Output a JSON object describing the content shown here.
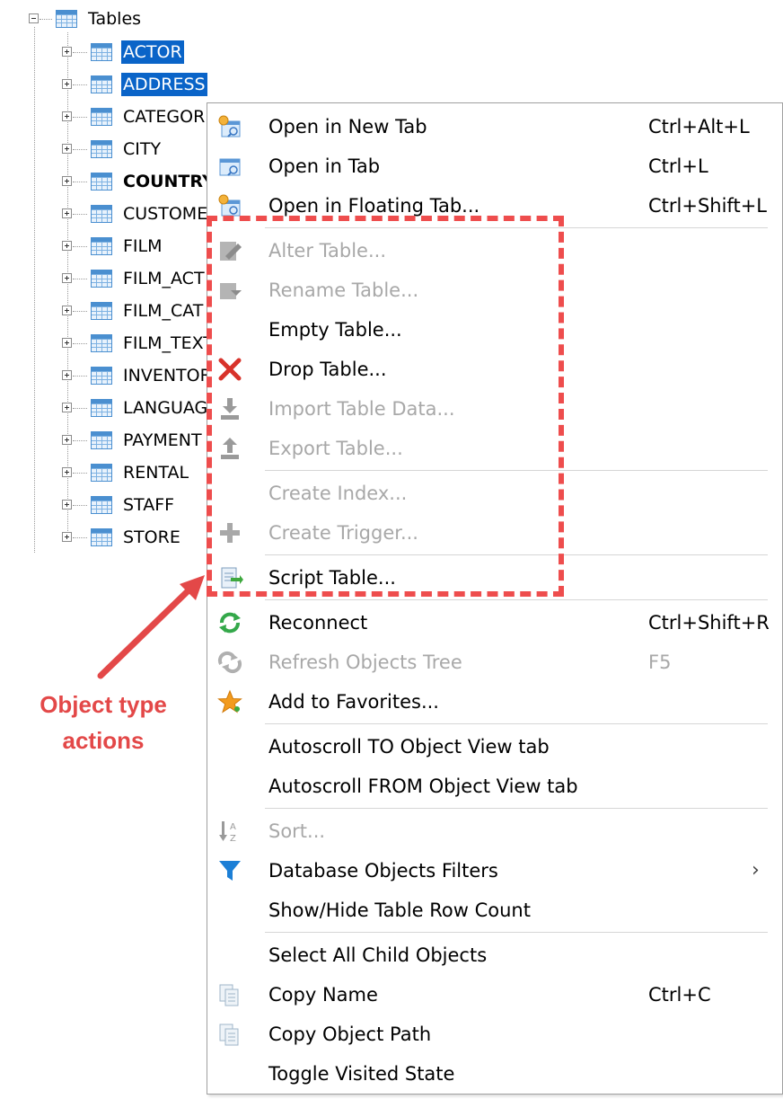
{
  "tree": {
    "root_label": "Tables",
    "items": [
      {
        "label": "ACTOR",
        "selected": true,
        "bold": false
      },
      {
        "label": "ADDRESS",
        "selected": true,
        "bold": false
      },
      {
        "label": "CATEGOR",
        "selected": false,
        "bold": false
      },
      {
        "label": "CITY",
        "selected": false,
        "bold": false
      },
      {
        "label": "COUNTRY",
        "selected": false,
        "bold": true
      },
      {
        "label": "CUSTOME",
        "selected": false,
        "bold": false
      },
      {
        "label": "FILM",
        "selected": false,
        "bold": false
      },
      {
        "label": "FILM_ACT",
        "selected": false,
        "bold": false
      },
      {
        "label": "FILM_CAT",
        "selected": false,
        "bold": false
      },
      {
        "label": "FILM_TEXT",
        "selected": false,
        "bold": false
      },
      {
        "label": "INVENTOR",
        "selected": false,
        "bold": false
      },
      {
        "label": "LANGUAGE",
        "selected": false,
        "bold": false
      },
      {
        "label": "PAYMENT",
        "selected": false,
        "bold": false
      },
      {
        "label": "RENTAL",
        "selected": false,
        "bold": false
      },
      {
        "label": "STAFF",
        "selected": false,
        "bold": false
      },
      {
        "label": "STORE",
        "selected": false,
        "bold": false
      }
    ]
  },
  "menu": {
    "open_new_tab": {
      "label": "Open in New Tab",
      "shortcut": "Ctrl+Alt+L",
      "icon": "open-new-tab-icon"
    },
    "open_tab": {
      "label": "Open in Tab",
      "shortcut": "Ctrl+L",
      "icon": "open-tab-icon"
    },
    "open_floating_tab": {
      "label": "Open in Floating Tab...",
      "shortcut": "Ctrl+Shift+L",
      "icon": "open-floating-tab-icon"
    },
    "alter_table": {
      "label": "Alter Table...",
      "icon": "alter-table-icon",
      "disabled": true
    },
    "rename_table": {
      "label": "Rename Table...",
      "icon": "rename-table-icon",
      "disabled": true
    },
    "empty_table": {
      "label": "Empty Table..."
    },
    "drop_table": {
      "label": "Drop Table...",
      "icon": "drop-x-icon"
    },
    "import_table_data": {
      "label": "Import Table Data...",
      "icon": "import-icon",
      "disabled": true
    },
    "export_table": {
      "label": "Export Table...",
      "icon": "export-icon",
      "disabled": true
    },
    "create_index": {
      "label": "Create Index...",
      "disabled": true
    },
    "create_trigger": {
      "label": "Create Trigger...",
      "icon": "plus-icon",
      "disabled": true
    },
    "script_table": {
      "label": "Script Table...",
      "icon": "script-icon"
    },
    "reconnect": {
      "label": "Reconnect",
      "shortcut": "Ctrl+Shift+R",
      "icon": "reconnect-icon"
    },
    "refresh_tree": {
      "label": "Refresh Objects Tree",
      "shortcut": "F5",
      "icon": "refresh-icon",
      "disabled": true
    },
    "add_favorites": {
      "label": "Add to Favorites...",
      "icon": "star-icon"
    },
    "autoscroll_to": {
      "label": "Autoscroll TO Object View tab"
    },
    "autoscroll_from": {
      "label": "Autoscroll FROM Object View tab"
    },
    "sort": {
      "label": "Sort...",
      "icon": "sort-az-icon",
      "disabled": true
    },
    "db_filters": {
      "label": "Database Objects Filters",
      "icon": "filter-icon",
      "submenu": true
    },
    "show_hide_count": {
      "label": "Show/Hide Table Row Count"
    },
    "select_all_child": {
      "label": "Select All Child Objects"
    },
    "copy_name": {
      "label": "Copy Name",
      "shortcut": "Ctrl+C",
      "icon": "copy-icon"
    },
    "copy_path": {
      "label": "Copy Object Path",
      "icon": "copy-icon"
    },
    "toggle_visited": {
      "label": "Toggle Visited State"
    }
  },
  "annotation": {
    "line1": "Object type",
    "line2": "actions",
    "color": "#e34848"
  },
  "colors": {
    "selection": "#0a64c8",
    "disabled_text": "#a8a8a8",
    "annotation_red": "#ee4d4d"
  }
}
